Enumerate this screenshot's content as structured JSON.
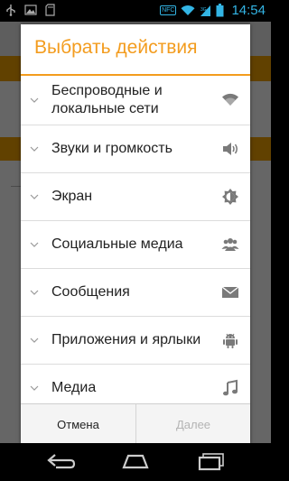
{
  "status_bar": {
    "time": "14:54",
    "nfc_label": "NFC",
    "icons": [
      "usb-icon",
      "image-icon",
      "sd-card-icon",
      "nfc-icon",
      "wifi-icon",
      "signal-icon",
      "battery-icon"
    ]
  },
  "dialog": {
    "title": "Выбрать действия",
    "items": [
      {
        "label": "Беспроводные и локальные сети",
        "icon": "wifi-icon"
      },
      {
        "label": "Звуки и громкость",
        "icon": "speaker-icon"
      },
      {
        "label": "Экран",
        "icon": "brightness-icon"
      },
      {
        "label": "Социальные медиа",
        "icon": "people-icon"
      },
      {
        "label": "Сообщения",
        "icon": "envelope-icon"
      },
      {
        "label": "Приложения и ярлыки",
        "icon": "android-icon"
      },
      {
        "label": "Медиа",
        "icon": "music-note-icon"
      }
    ],
    "cancel_label": "Отмена",
    "next_label": "Далее"
  },
  "colors": {
    "accent": "#f39c1e",
    "status_blue": "#33b5e5",
    "disabled_text": "#b4b4b4"
  },
  "nav_bar": {
    "buttons": [
      "back-icon",
      "home-icon",
      "recents-icon"
    ]
  }
}
